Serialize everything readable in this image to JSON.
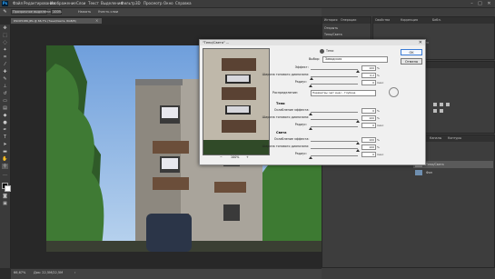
{
  "app": {
    "logo": "Ps"
  },
  "menu": [
    "Файл",
    "Редактирование",
    "Изображение",
    "Слои",
    "Текст",
    "Выделение",
    "Фильтр",
    "3D",
    "Просмотр",
    "Окно",
    "Справка"
  ],
  "window_controls": {
    "minimize": "–",
    "maximize": "□",
    "close": "✕"
  },
  "options_bar": {
    "brush_mode": "Прозрачное выделение",
    "opacity": "100%",
    "flow": "Нажать",
    "sample": "Учесть слои"
  },
  "document": {
    "tab_title": "DSC05186.JPG @ 66,7% (Тени/Света, RGB/8)",
    "close": "×"
  },
  "status": {
    "zoom": "66,67%",
    "doc": "Док: 22,5M/22,5M",
    "arrow": "›"
  },
  "panels": {
    "history": {
      "tabs": [
        "История",
        "Операции"
      ],
      "rows": [
        "Открыть",
        "Тени/Света"
      ]
    },
    "properties": {
      "tabs": [
        "Свойства",
        "Коррекция",
        "Библ."
      ],
      "text": "Нет свойств"
    },
    "adjustments": {
      "tabs": [
        "Стили",
        "Образцы"
      ]
    },
    "layers": {
      "tabs": [
        "Слои",
        "Каналы",
        "Контуры"
      ],
      "rows": [
        "Тени/Света",
        "Фон"
      ]
    }
  },
  "dialog": {
    "title": "\"Тени/Света\" ...",
    "close": "✕",
    "preview_zoom": "100%",
    "zoom_out": "−",
    "zoom_in": "+",
    "amount_label": "Выбор:",
    "amount_value": "Заводская",
    "section_shadows_icon_text": "Тени",
    "shadows": [
      {
        "label": "Эффект:",
        "value": "100",
        "unit": "%",
        "pos": 1.0
      },
      {
        "label": "Ширина тонового диапазона:",
        "value": "0,2",
        "unit": "%",
        "pos": 0.02
      },
      {
        "label": "Радиус:",
        "value": "0",
        "unit": "пикс",
        "pos": 0.0
      }
    ],
    "extra": {
      "label": "Распределение:",
      "value": "Параметры (нет инд.) - Глубина"
    },
    "section_middle": "Тени",
    "middle": [
      {
        "label": "Ослабление эффекта:",
        "value": "0",
        "unit": "%",
        "pos": 0.0
      },
      {
        "label": "Ширина тонового диапазона:",
        "value": "100",
        "unit": "%",
        "pos": 1.0
      },
      {
        "label": "Радиус:",
        "value": "0",
        "unit": "пикс",
        "pos": 0.0
      }
    ],
    "section_highlights": "Света",
    "highlights": [
      {
        "label": "Ослабление эффекта:",
        "value": "100",
        "unit": "%",
        "pos": 1.0
      },
      {
        "label": "Ширина тонового диапазона:",
        "value": "100",
        "unit": "%",
        "pos": 1.0
      },
      {
        "label": "Радиус:",
        "value": "0",
        "unit": "пикс",
        "pos": 0.0
      }
    ],
    "ok": "OK",
    "cancel": "Отмена"
  }
}
